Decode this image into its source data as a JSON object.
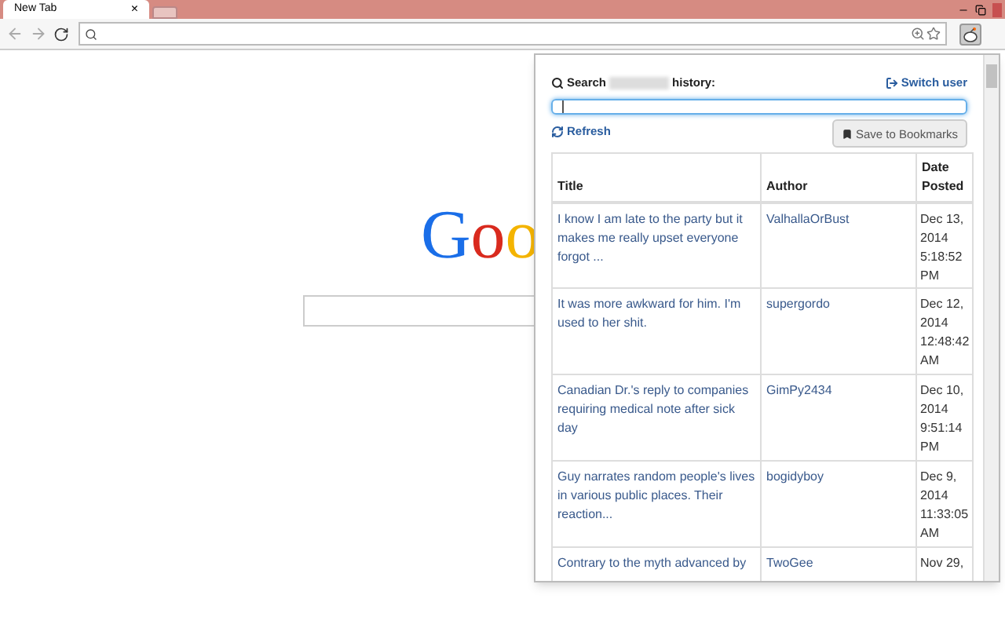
{
  "browser": {
    "tabs": [
      {
        "title": "New Tab",
        "close": "×",
        "selected": true
      },
      {
        "selected": false
      }
    ]
  },
  "logo": {
    "letters": [
      {
        "text": "G",
        "color": "#1a6ee8"
      },
      {
        "text": "o",
        "color": "#d92a1e"
      },
      {
        "text": "o",
        "color": "#f4b400"
      }
    ]
  },
  "popup": {
    "search_label": "Search",
    "search_label_end": "history:",
    "switch_user": "Switch user",
    "refresh": "Refresh",
    "save": "Save to Bookmarks",
    "table": {
      "columns": [
        "Title",
        "Author",
        "Date Posted"
      ],
      "rows": [
        {
          "title": "I know I am late to the party but it makes me really upset everyone forgot ...",
          "author": "ValhallaOrBust",
          "date": "Dec 13, 2014 5:18:52 PM"
        },
        {
          "title": "It was more awkward for him. I'm used to her shit.",
          "author": "supergordo",
          "date": "Dec 12, 2014 12:48:42 AM"
        },
        {
          "title": "Canadian Dr.'s reply to companies requiring medical note after sick day",
          "author": "GimPy2434",
          "date": "Dec 10, 2014 9:51:14 PM"
        },
        {
          "title": "Guy narrates random people's lives in various public places. Their reaction...",
          "author": "bogidyboy",
          "date": "Dec 9, 2014 11:33:05 AM"
        },
        {
          "title": "Contrary to the myth advanced by",
          "author": "TwoGee",
          "date": "Nov 29,"
        }
      ]
    }
  }
}
